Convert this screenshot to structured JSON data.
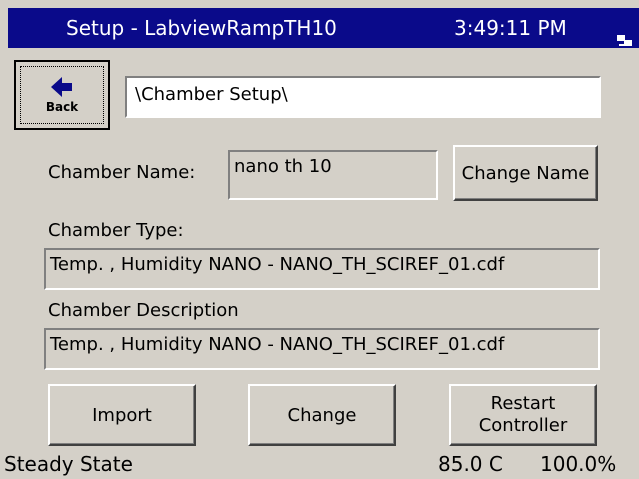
{
  "titlebar": {
    "title": "Setup - LabviewRampTH10",
    "time": "3:49:11 PM",
    "tray_icon": "network-icon"
  },
  "back_button": {
    "label": "Back",
    "icon": "back-arrow-icon"
  },
  "path": "\\Chamber Setup\\",
  "chamber_name": {
    "label": "Chamber Name:",
    "value": "nano th 10"
  },
  "change_name_button": "Change Name",
  "chamber_type": {
    "label": "Chamber Type:",
    "value": "Temp. , Humidity NANO - NANO_TH_SCIREF_01.cdf"
  },
  "chamber_description": {
    "label": "Chamber Description",
    "value": "Temp. , Humidity NANO - NANO_TH_SCIREF_01.cdf"
  },
  "buttons": {
    "import": "Import",
    "change": "Change",
    "restart_line1": "Restart",
    "restart_line2": "Controller"
  },
  "status_bar": {
    "state": "Steady State",
    "temperature": "85.0 C",
    "humidity": "100.0%"
  },
  "colors": {
    "titlebar": "#0a0a8a",
    "background": "#d4d0c8"
  }
}
